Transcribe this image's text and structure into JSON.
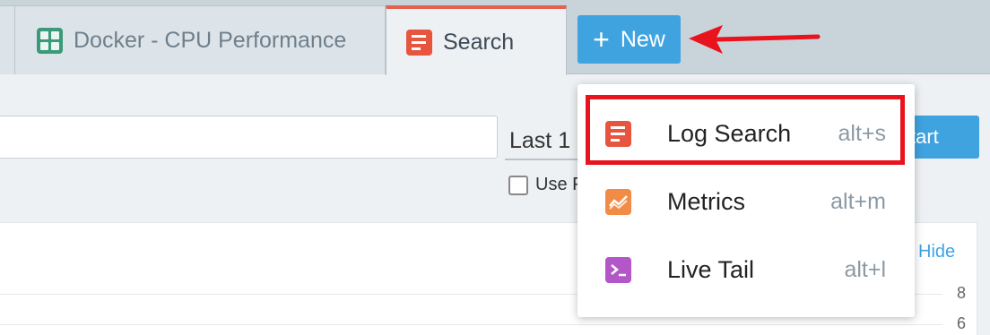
{
  "tabs": [
    {
      "label": "Docker - CPU Performance",
      "icon": "grid-icon",
      "active": false
    },
    {
      "label": "Search",
      "icon": "log-search-icon",
      "active": true
    }
  ],
  "new_button": {
    "label": "New",
    "icon": "plus-icon"
  },
  "toolbar": {
    "time_range": "Last 1",
    "start_label": "tart",
    "use_label": "Use F"
  },
  "chart": {
    "ticks": [
      "8",
      "6"
    ],
    "hide_label": "Hide"
  },
  "menu": {
    "items": [
      {
        "label": "Log Search",
        "shortcut": "alt+s",
        "icon": "log-search-icon"
      },
      {
        "label": "Metrics",
        "shortcut": "alt+m",
        "icon": "metrics-icon"
      },
      {
        "label": "Live Tail",
        "shortcut": "alt+l",
        "icon": "terminal-icon"
      }
    ]
  },
  "colors": {
    "accent": "#3fa3e0",
    "active_tab_border": "#e5604e",
    "highlight": "#e8131c",
    "arrow": "#e8131c"
  }
}
